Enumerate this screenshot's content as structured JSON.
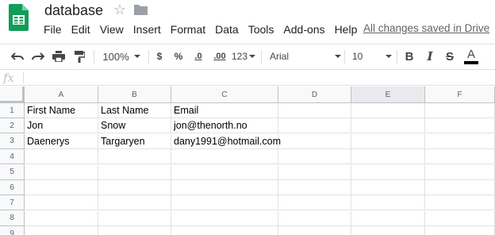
{
  "app": {
    "doc_title": "database",
    "logo_icon": "sheets-logo-icon",
    "brand_color": "#0f9d58",
    "save_status": "All changes saved in Drive"
  },
  "menu": [
    "File",
    "Edit",
    "View",
    "Insert",
    "Format",
    "Data",
    "Tools",
    "Add-ons",
    "Help"
  ],
  "toolbar": {
    "zoom": "100%",
    "currency": "$",
    "percent": "%",
    "decrease_decimal": ".0",
    "increase_decimal": ".00",
    "more_formats": "123",
    "font": "Arial",
    "font_size": "10",
    "bold": "B",
    "italic": "I",
    "strikethrough": "S",
    "text_color": "A"
  },
  "formula_bar": {
    "fx": "fx",
    "value": ""
  },
  "sheet": {
    "columns": [
      "A",
      "B",
      "C",
      "D",
      "E",
      "F"
    ],
    "selected_column": "E",
    "row_numbers": [
      "1",
      "2",
      "3",
      "4",
      "5",
      "6",
      "7",
      "8",
      "9"
    ],
    "rows": [
      [
        "First Name",
        "Last Name",
        "Email",
        "",
        "",
        ""
      ],
      [
        "Jon",
        "Snow",
        "jon@thenorth.no",
        "",
        "",
        ""
      ],
      [
        "Daenerys",
        "Targaryen",
        "dany1991@hotmail.com",
        "",
        "",
        ""
      ],
      [
        "",
        "",
        "",
        "",
        "",
        ""
      ],
      [
        "",
        "",
        "",
        "",
        "",
        ""
      ],
      [
        "",
        "",
        "",
        "",
        "",
        ""
      ],
      [
        "",
        "",
        "",
        "",
        "",
        ""
      ],
      [
        "",
        "",
        "",
        "",
        "",
        ""
      ],
      [
        "",
        "",
        "",
        "",
        "",
        ""
      ]
    ]
  }
}
